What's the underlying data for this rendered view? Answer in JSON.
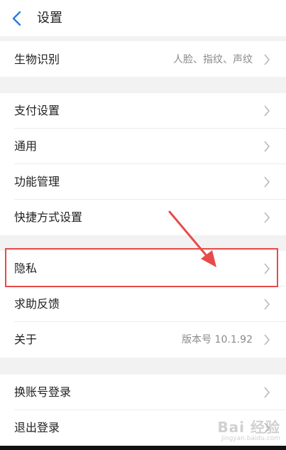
{
  "header": {
    "title": "设置"
  },
  "groups": [
    {
      "items": [
        {
          "label": "生物识别",
          "value": "人脸、指纹、声纹"
        }
      ]
    },
    {
      "items": [
        {
          "label": "支付设置",
          "value": ""
        },
        {
          "label": "通用",
          "value": ""
        },
        {
          "label": "功能管理",
          "value": ""
        },
        {
          "label": "快捷方式设置",
          "value": ""
        }
      ]
    },
    {
      "items": [
        {
          "label": "隐私",
          "value": ""
        },
        {
          "label": "求助反馈",
          "value": ""
        },
        {
          "label": "关于",
          "value": "版本号 10.1.92"
        }
      ]
    },
    {
      "items": [
        {
          "label": "换账号登录",
          "value": ""
        },
        {
          "label": "退出登录",
          "value": ""
        }
      ]
    }
  ],
  "watermark": {
    "logo": "Bai 经验",
    "url": "jingyan.baidu.com"
  },
  "colors": {
    "highlight": "#e84a4a",
    "background": "#f2f2f2",
    "accent": "#2a7ae2"
  }
}
